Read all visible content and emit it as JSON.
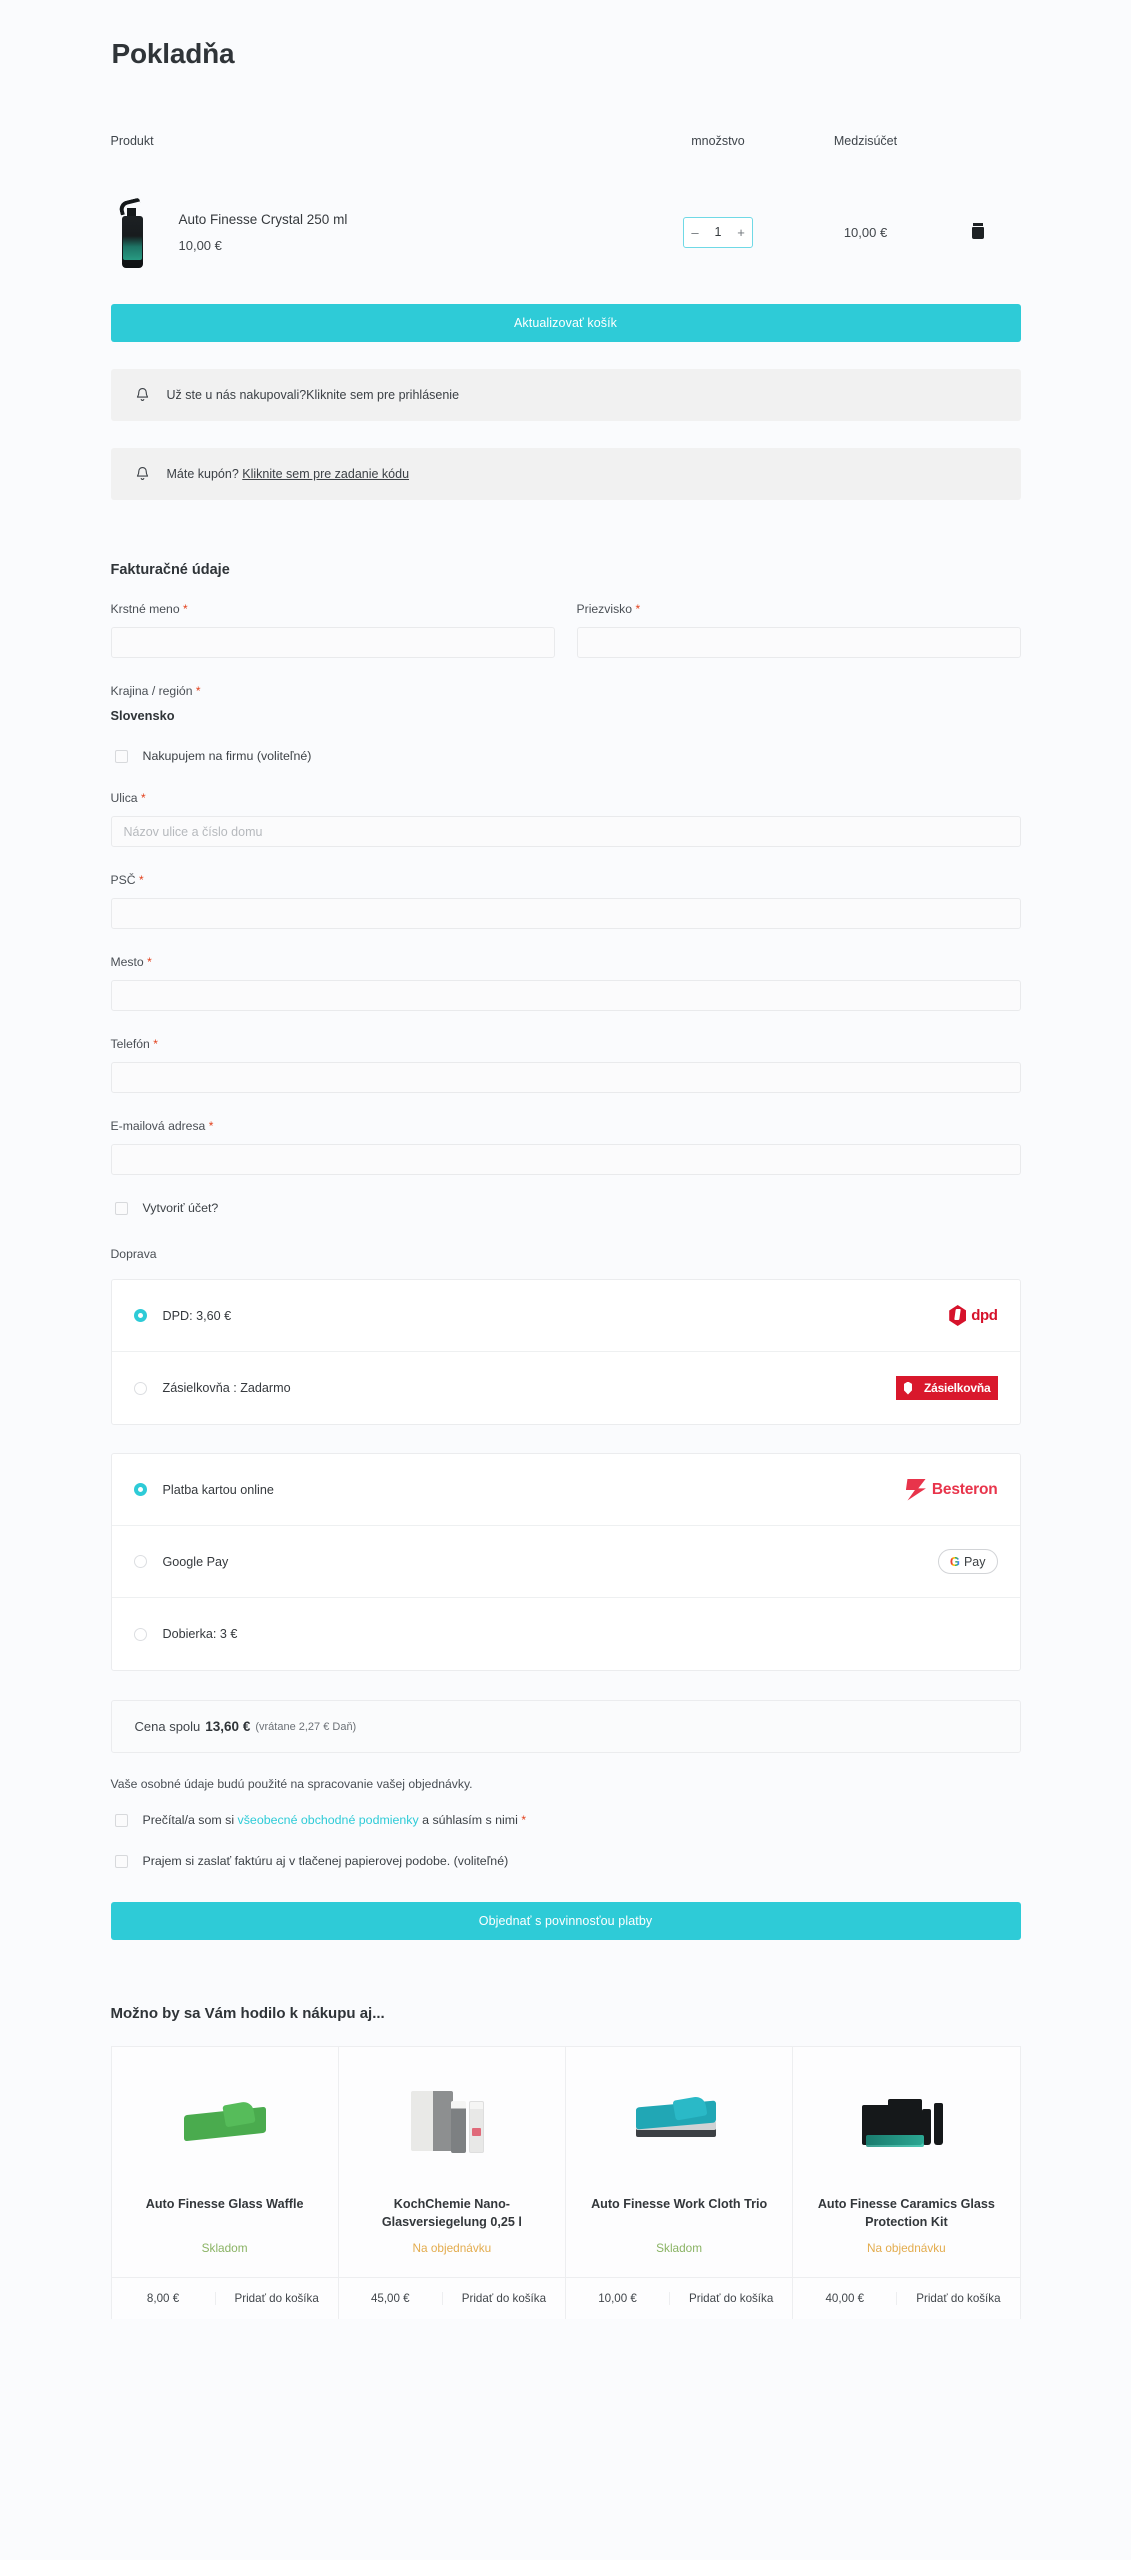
{
  "page": {
    "title": "Pokladňa",
    "accent_color": "#2ecbd7",
    "required_mark": "*"
  },
  "cart": {
    "headers": {
      "product": "Produkt",
      "quantity": "množstvo",
      "subtotal": "Medzisúčet"
    },
    "items": [
      {
        "name": "Auto Finesse Crystal 250 ml",
        "price": "10,00 €",
        "quantity": "1",
        "subtotal": "10,00 €",
        "decrease_label": "–",
        "increase_label": "+"
      }
    ],
    "update_button": "Aktualizovať košík"
  },
  "notices": {
    "login": {
      "text": "Už ste u nás nakupovali?",
      "link": "Kliknite sem pre prihlásenie"
    },
    "coupon": {
      "text": "Máte kupón?",
      "link": "Kliknite sem pre zadanie kódu"
    }
  },
  "billing": {
    "section_title": "Fakturačné údaje",
    "first_name_label": "Krstné meno",
    "first_name_value": "",
    "last_name_label": "Priezvisko",
    "last_name_value": "",
    "country_label": "Krajina / región",
    "country_value": "Slovensko",
    "company_checkbox_label": "Nakupujem na firmu (voliteľné)",
    "street_label": "Ulica",
    "street_placeholder": "Názov ulice a číslo domu",
    "street_value": "",
    "zip_label": "PSČ",
    "zip_value": "",
    "city_label": "Mesto",
    "city_value": "",
    "phone_label": "Telefón",
    "phone_value": "",
    "email_label": "E-mailová adresa",
    "email_value": "",
    "create_account_label": "Vytvoriť účet?"
  },
  "shipping": {
    "section_title": "Doprava",
    "options": [
      {
        "label": "DPD: 3,60 €",
        "selected": true,
        "logo": "dpd-logo",
        "logo_text": "dpd"
      },
      {
        "label": "Zásielkovňa : Zadarmo",
        "selected": false,
        "logo": "zasielkovna-logo",
        "logo_text": "Zásielkovňa"
      }
    ]
  },
  "payment": {
    "options": [
      {
        "label": "Platba kartou online",
        "selected": true,
        "logo": "besteron-logo",
        "logo_text": "Besteron"
      },
      {
        "label": "Google Pay",
        "selected": false,
        "logo": "google-pay-logo",
        "logo_text": "Pay",
        "logo_glyph": "G"
      },
      {
        "label": "Dobierka: 3 €",
        "selected": false,
        "logo": "",
        "logo_text": ""
      }
    ]
  },
  "summary": {
    "total_label": "Cena spolu",
    "total_amount": "13,60 €",
    "tax_note": "(vrátane 2,27 € Daň)",
    "privacy_text": "Vaše osobné údaje budú použité na spracovanie vašej objednávky.",
    "terms_prefix": "Prečítal/a som si ",
    "terms_link": "všeobecné obchodné podmienky",
    "terms_suffix": " a súhlasím s nimi ",
    "invoice_checkbox_label": "Prajem si zaslať faktúru aj v tlačenej papierovej podobe. (voliteľné)",
    "order_button": "Objednať s povinnosťou platby"
  },
  "upsell": {
    "title": "Možno by sa Vám hodilo k nákupu aj...",
    "add_label": "Pridať do košíka",
    "products": [
      {
        "name": "Auto Finesse Glass Waffle",
        "stock": "Skladom",
        "stock_state": "in",
        "price": "8,00 €",
        "image": "green-waffle-cloth"
      },
      {
        "name": "KochChemie Nano-Glasversiegelung 0,25 l",
        "stock": "Na objednávku",
        "stock_state": "order",
        "price": "45,00 €",
        "image": "kochchemie-bottles-box"
      },
      {
        "name": "Auto Finesse Work Cloth Trio",
        "stock": "Skladom",
        "stock_state": "in",
        "price": "10,00 €",
        "image": "teal-cloth-stack"
      },
      {
        "name": "Auto Finesse Caramics Glass Protection Kit",
        "stock": "Na objednávku",
        "stock_state": "order",
        "price": "40,00 €",
        "image": "caramics-kit-boxes"
      }
    ]
  }
}
